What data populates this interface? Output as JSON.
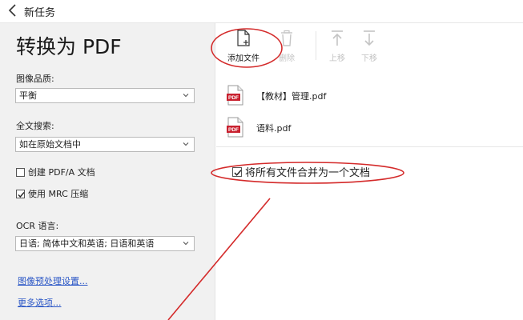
{
  "titlebar": {
    "title": "新任务"
  },
  "left": {
    "heading": "转换为 PDF",
    "image_quality": {
      "label": "图像品质:",
      "value": "平衡"
    },
    "fulltext": {
      "label": "全文搜索:",
      "value": "如在原始文档中"
    },
    "pdfa": {
      "label": "创建 PDF/A 文档",
      "checked": false
    },
    "mrc": {
      "label": "使用 MRC 压缩",
      "checked": true
    },
    "ocr": {
      "label": "OCR 语言:",
      "value": "日语; 简体中文和英语; 日语和英语"
    },
    "links": {
      "preprocess": "图像预处理设置...",
      "more": "更多选项..."
    }
  },
  "toolbar": {
    "add": "添加文件",
    "delete": "删除",
    "up": "上移",
    "down": "下移"
  },
  "files": [
    {
      "name": "【教材】管理.pdf",
      "icon": "pdf-icon"
    },
    {
      "name": "语料.pdf",
      "icon": "pdf-icon"
    }
  ],
  "merge": {
    "label": "将所有文件合并为一个文档",
    "checked": true
  },
  "colors": {
    "annotation": "#d42a2a",
    "link": "#2a56c6",
    "pdf": "#c8202e"
  }
}
